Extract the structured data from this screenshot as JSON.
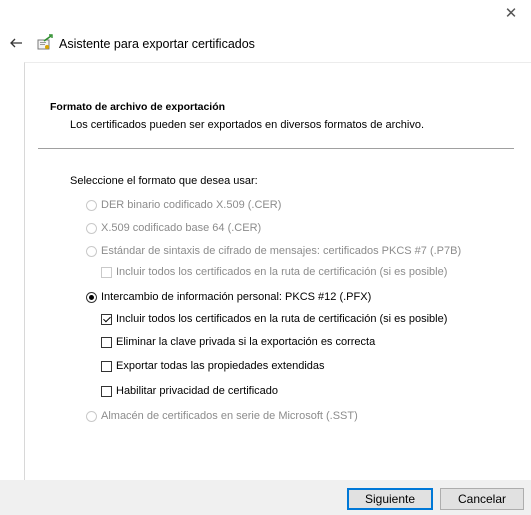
{
  "window": {
    "title": "Asistente para exportar certificados",
    "close_glyph": "✕",
    "back_icon": "back-arrow-icon",
    "wizard_icon": "certificate-wizard-icon"
  },
  "section": {
    "title": "Formato de archivo de exportación",
    "description": "Los certificados pueden ser exportados en diversos formatos de archivo."
  },
  "prompt": "Seleccione el formato que desea usar:",
  "options": [
    {
      "type": "radio",
      "label": "DER binario codificado X.509 (.CER)",
      "checked": false,
      "enabled": false
    },
    {
      "type": "radio",
      "label": "X.509 codificado base 64 (.CER)",
      "checked": false,
      "enabled": false
    },
    {
      "type": "radio",
      "label": "Estándar de sintaxis de cifrado de mensajes: certificados PKCS #7 (.P7B)",
      "checked": false,
      "enabled": false
    },
    {
      "type": "checkbox",
      "label": "Incluir todos los certificados en la ruta de certificación (si es posible)",
      "checked": false,
      "enabled": false
    },
    {
      "type": "radio",
      "label": "Intercambio de información personal: PKCS #12 (.PFX)",
      "checked": true,
      "enabled": true
    },
    {
      "type": "checkbox",
      "label": "Incluir todos los certificados en la ruta de certificación (si es posible)",
      "checked": true,
      "enabled": true
    },
    {
      "type": "checkbox",
      "label": "Eliminar la clave privada si la exportación es correcta",
      "checked": false,
      "enabled": true
    },
    {
      "type": "checkbox",
      "label": "Exportar todas las propiedades extendidas",
      "checked": false,
      "enabled": true
    },
    {
      "type": "checkbox",
      "label": "Habilitar privacidad de certificado",
      "checked": false,
      "enabled": true
    },
    {
      "type": "radio",
      "label": "Almacén de certificados en serie de Microsoft (.SST)",
      "checked": false,
      "enabled": false
    }
  ],
  "buttons": {
    "next": "Siguiente",
    "cancel": "Cancelar"
  },
  "colors": {
    "accent": "#0078d7",
    "disabled_text": "#8c8c8c",
    "footer_bg": "#f0f0f0"
  }
}
